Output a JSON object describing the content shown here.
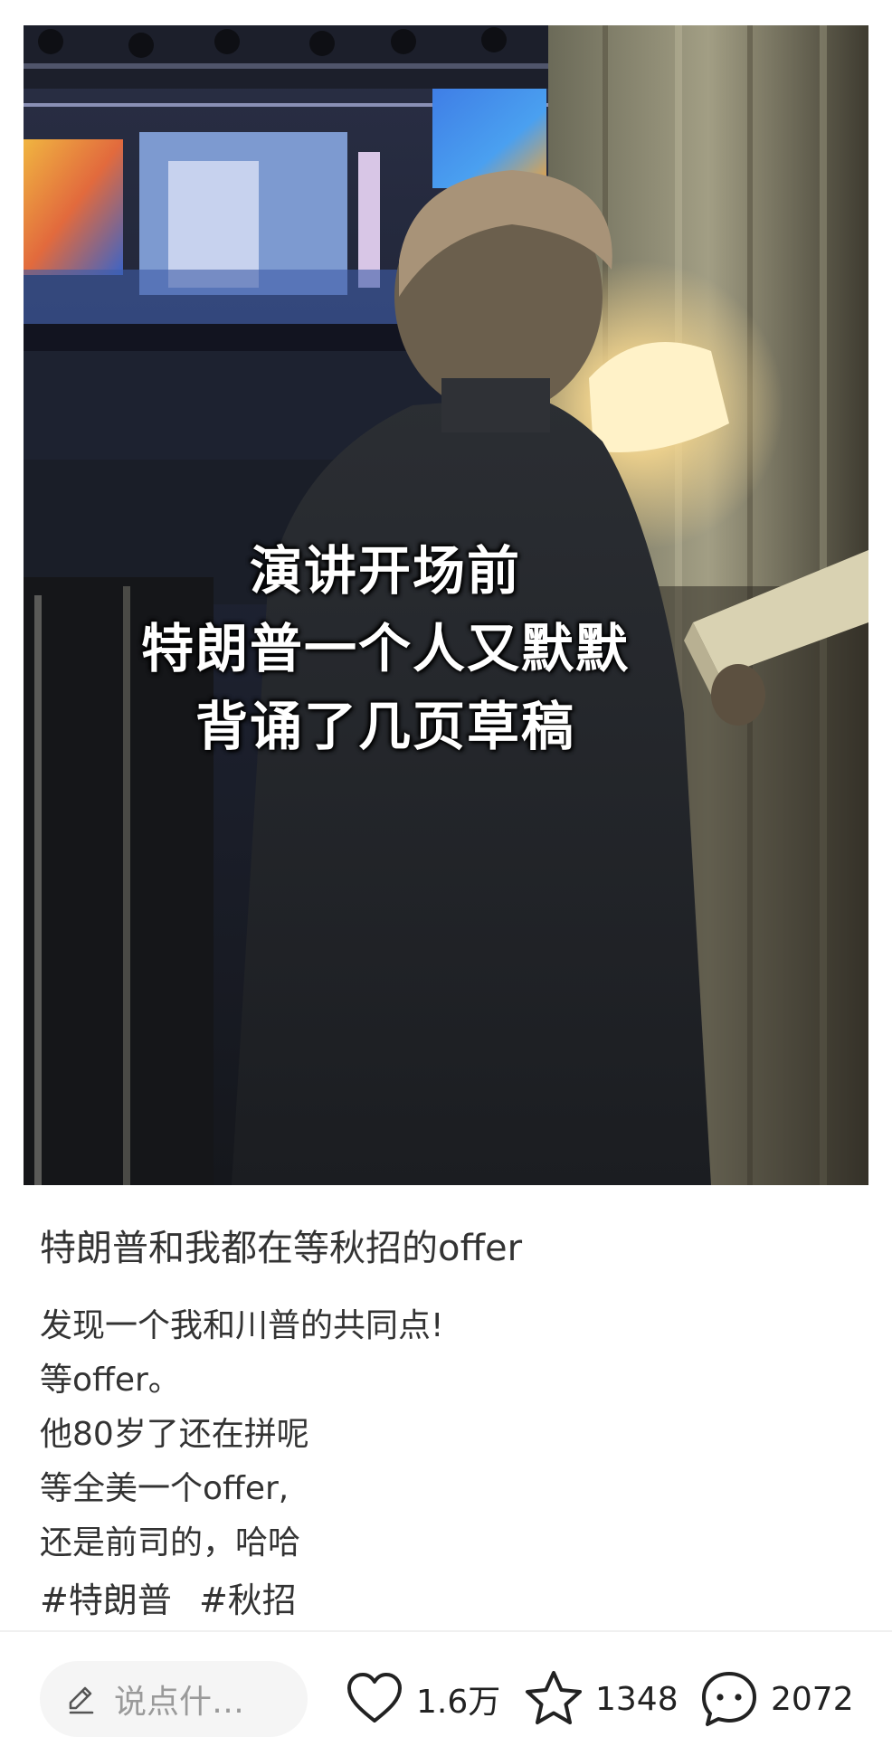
{
  "media": {
    "caption_lines": [
      "演讲开场前",
      "特朗普一个人又默默",
      "背诵了几页草稿"
    ]
  },
  "post": {
    "title": "特朗普和我都在等秋招的offer",
    "body_lines": [
      "发现一个我和川普的共同点!",
      "等offer。",
      "他80岁了还在拼呢",
      "等全美一个offer,",
      "还是前司的，哈哈"
    ],
    "tags": [
      "#特朗普",
      "#秋招"
    ]
  },
  "bottom_bar": {
    "comment_placeholder": "说点什…",
    "like_count": "1.6万",
    "favorite_count": "1348",
    "comment_count": "2072"
  },
  "icons": {
    "pen": "pen-icon",
    "like": "heart-icon",
    "favorite": "star-icon",
    "comment": "chat-bubble-icon"
  }
}
